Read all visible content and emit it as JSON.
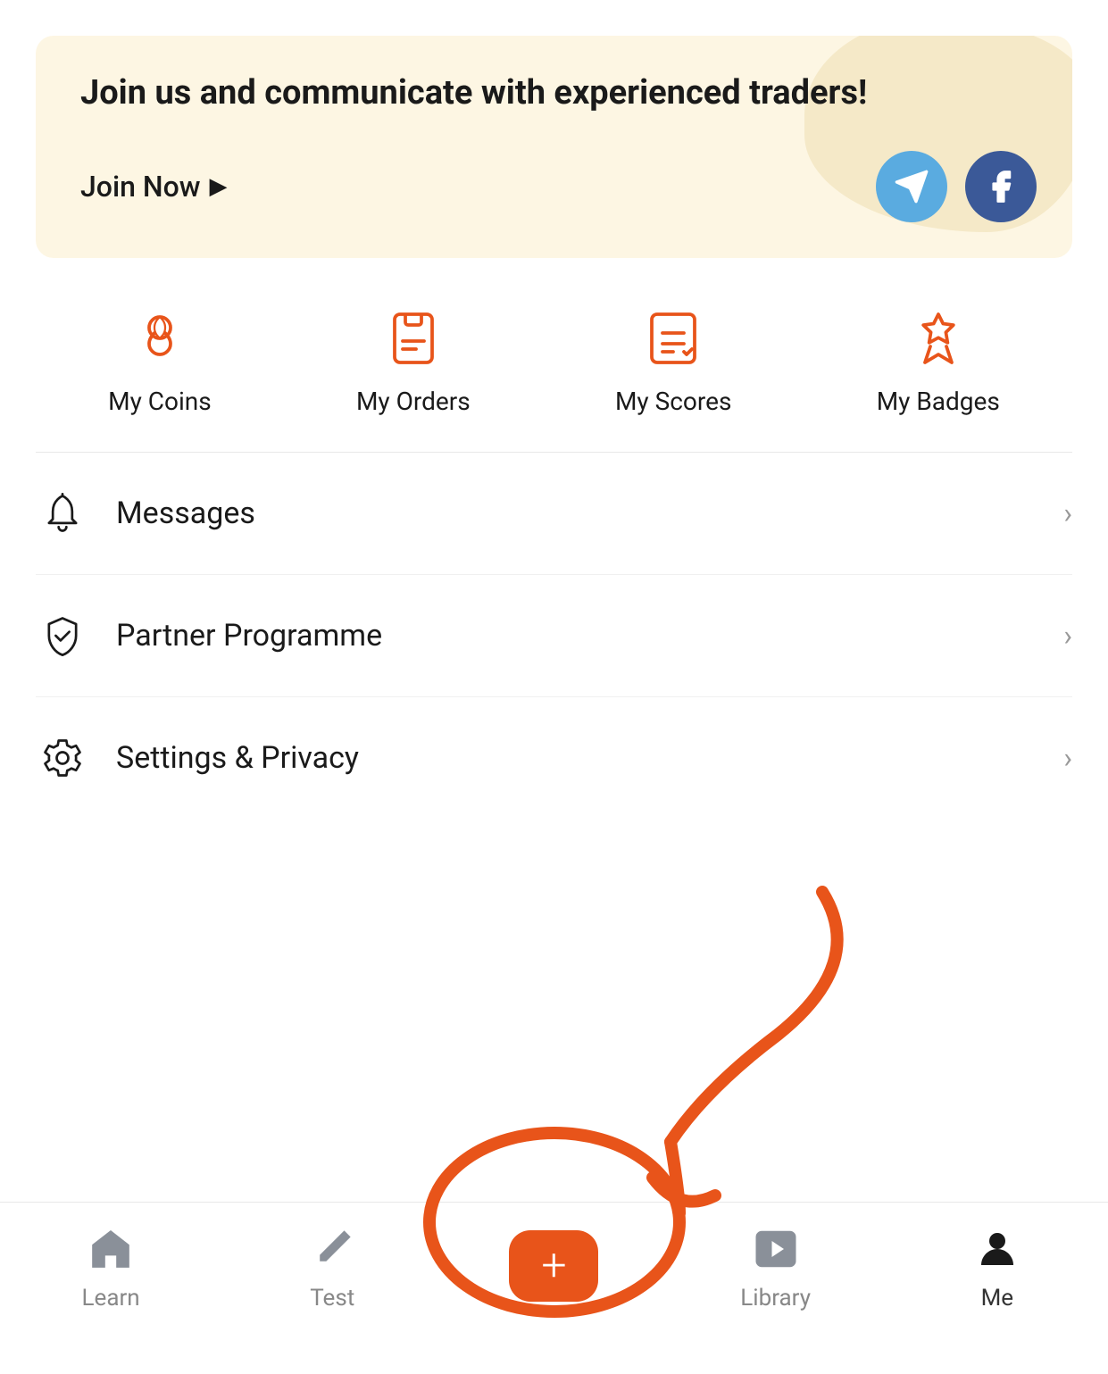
{
  "banner": {
    "title": "Join us and communicate with experienced traders!",
    "join_label": "Join Now",
    "telegram_alt": "Telegram",
    "facebook_alt": "Facebook"
  },
  "quick_actions": [
    {
      "id": "coins",
      "label": "My Coins",
      "icon": "coins-icon"
    },
    {
      "id": "orders",
      "label": "My Orders",
      "icon": "orders-icon"
    },
    {
      "id": "scores",
      "label": "My Scores",
      "icon": "scores-icon"
    },
    {
      "id": "badges",
      "label": "My Badges",
      "icon": "badges-icon"
    }
  ],
  "menu_items": [
    {
      "id": "messages",
      "label": "Messages",
      "icon": "bell-icon"
    },
    {
      "id": "partner",
      "label": "Partner Programme",
      "icon": "shield-icon"
    },
    {
      "id": "settings",
      "label": "Settings & Privacy",
      "icon": "settings-icon"
    }
  ],
  "nav": {
    "items": [
      {
        "id": "learn",
        "label": "Learn",
        "icon": "home-icon",
        "active": false
      },
      {
        "id": "test",
        "label": "Test",
        "icon": "pencil-icon",
        "active": false
      },
      {
        "id": "add",
        "label": "",
        "icon": "plus-icon",
        "active": false
      },
      {
        "id": "library",
        "label": "Library",
        "icon": "play-icon",
        "active": false
      },
      {
        "id": "me",
        "label": "Me",
        "icon": "person-icon",
        "active": true
      }
    ]
  }
}
